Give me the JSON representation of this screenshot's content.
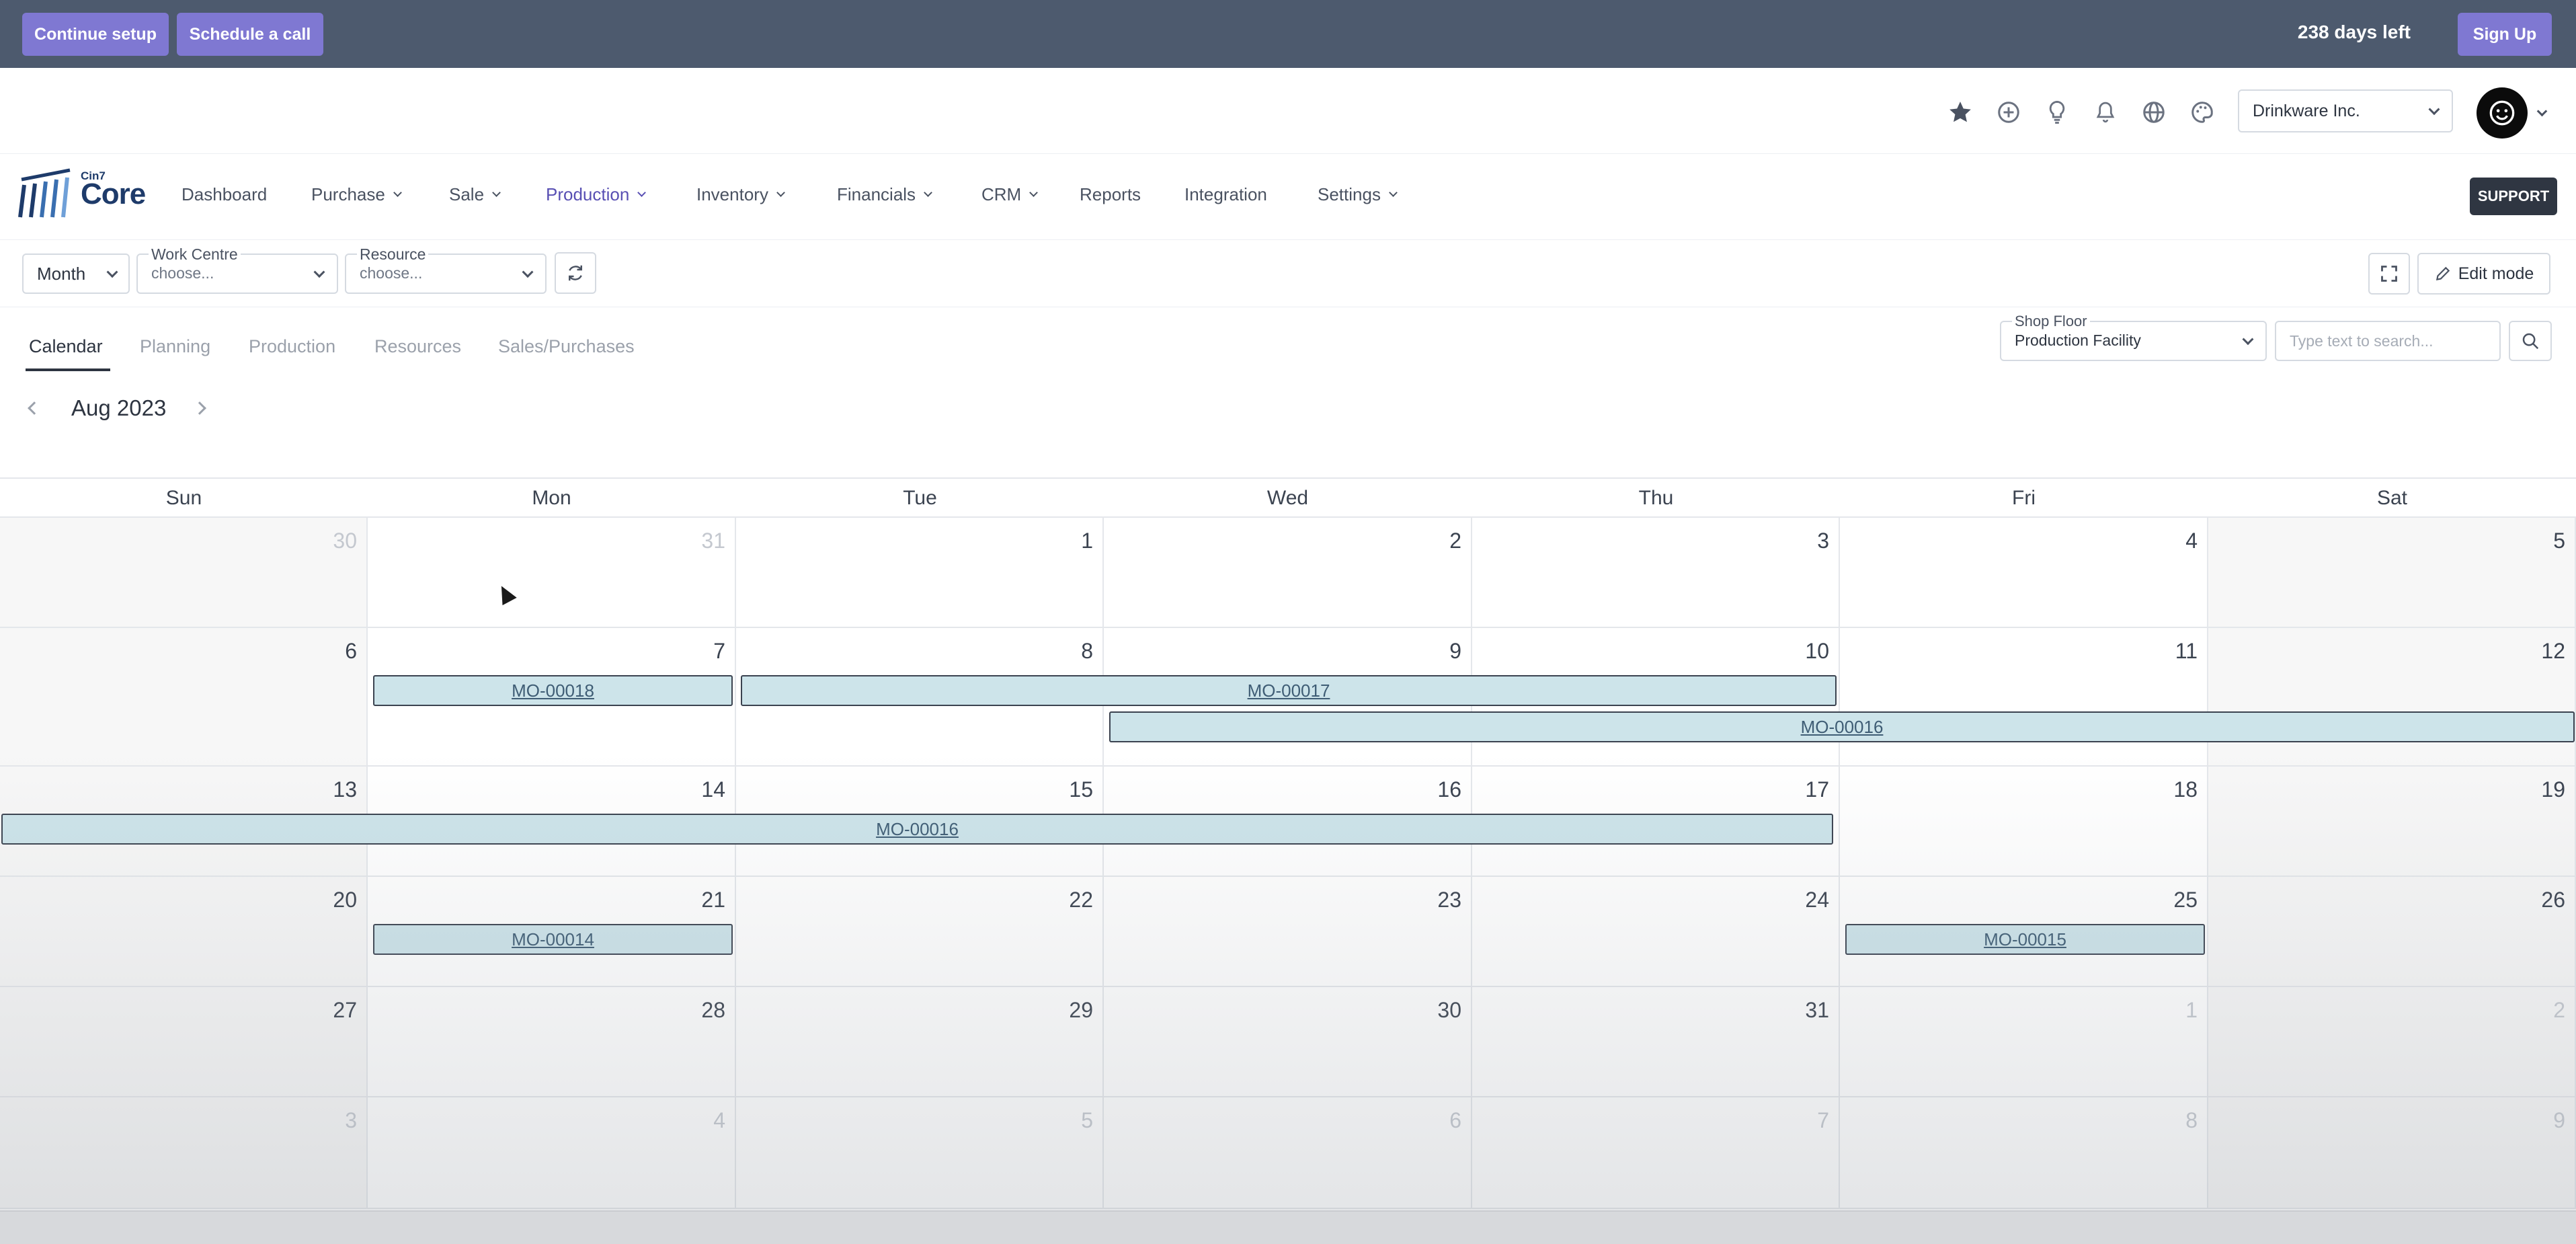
{
  "banner": {
    "continue_setup": "Continue setup",
    "schedule_call": "Schedule a call",
    "days_left": "238 days left",
    "sign_up": "Sign Up"
  },
  "header": {
    "icons": [
      "star-icon",
      "plus-circle-icon",
      "lightbulb-icon",
      "bell-icon",
      "globe-icon",
      "palette-icon"
    ],
    "company": "Drinkware Inc."
  },
  "logo": {
    "small": "Cin7",
    "main": "Core"
  },
  "nav": {
    "items": [
      {
        "label": "Dashboard",
        "caret": false
      },
      {
        "label": "Purchase",
        "caret": true
      },
      {
        "label": "Sale",
        "caret": true
      },
      {
        "label": "Production",
        "caret": true,
        "active": true
      },
      {
        "label": "Inventory",
        "caret": true
      },
      {
        "label": "Financials",
        "caret": true
      },
      {
        "label": "CRM",
        "caret": true
      },
      {
        "label": "Reports",
        "caret": false
      },
      {
        "label": "Integration",
        "caret": false
      },
      {
        "label": "Settings",
        "caret": true
      }
    ],
    "support": "SUPPORT"
  },
  "toolbar": {
    "view": "Month",
    "work_centre": {
      "label": "Work Centre",
      "placeholder": "choose..."
    },
    "resource": {
      "label": "Resource",
      "placeholder": "choose..."
    },
    "edit_mode": "Edit mode"
  },
  "tabs": [
    "Calendar",
    "Planning",
    "Production",
    "Resources",
    "Sales/Purchases"
  ],
  "shop_floor": {
    "label": "Shop Floor",
    "value": "Production Facility"
  },
  "search": {
    "placeholder": "Type text to search..."
  },
  "calendar": {
    "month": "Aug 2023",
    "days_of_week": [
      "Sun",
      "Mon",
      "Tue",
      "Wed",
      "Thu",
      "Fri",
      "Sat"
    ],
    "weeks": [
      [
        "30",
        "31",
        "1",
        "2",
        "3",
        "4",
        "5"
      ],
      [
        "6",
        "7",
        "8",
        "9",
        "10",
        "11",
        "12"
      ],
      [
        "13",
        "14",
        "15",
        "16",
        "17",
        "18",
        "19"
      ],
      [
        "20",
        "21",
        "22",
        "23",
        "24",
        "25",
        "26"
      ],
      [
        "27",
        "28",
        "29",
        "30",
        "31",
        "1",
        "2"
      ],
      [
        "3",
        "4",
        "5",
        "6",
        "7",
        "8",
        "9"
      ]
    ],
    "events": [
      {
        "label": "MO-00018"
      },
      {
        "label": "MO-00017"
      },
      {
        "label": "MO-00016"
      },
      {
        "label": "MO-00016"
      },
      {
        "label": "MO-00014"
      },
      {
        "label": "MO-00015"
      }
    ]
  }
}
